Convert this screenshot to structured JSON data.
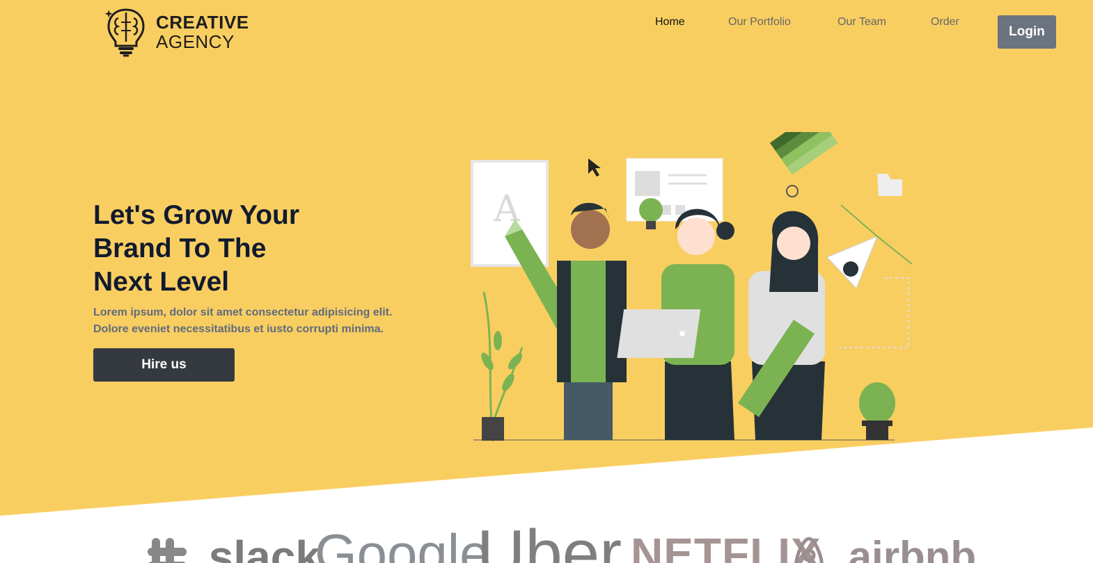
{
  "brand": {
    "line1": "CREATIVE",
    "line2": "AGENCY",
    "icon": "brain-lightbulb-icon"
  },
  "nav": {
    "items": [
      {
        "label": "Home",
        "active": true
      },
      {
        "label": "Our Portfolio",
        "active": false
      },
      {
        "label": "Our Team",
        "active": false
      },
      {
        "label": "Order",
        "active": false
      }
    ],
    "login_label": "Login"
  },
  "hero": {
    "title_lines": [
      "Let's Grow Your",
      "Brand To The",
      "Next Level"
    ],
    "description": "Lorem ipsum, dolor sit amet consectetur adipisicing elit. Dolore eveniet necessitatibus et iusto corrupti minima.",
    "cta_label": "Hire us",
    "illustration_letter": "A"
  },
  "clients": {
    "logos": [
      {
        "name": "slack",
        "text": "slack"
      },
      {
        "name": "google",
        "text": "Google"
      },
      {
        "name": "uber",
        "text": "Uber"
      },
      {
        "name": "netflix",
        "text": "NETFLIX"
      },
      {
        "name": "airbnb",
        "text": "airbnb"
      }
    ]
  },
  "colors": {
    "hero_background": "#F9CE61",
    "primary_button": "#343A40",
    "login_button": "#6B7280",
    "accent_green": "#7CB352",
    "heading": "#111A2E"
  }
}
